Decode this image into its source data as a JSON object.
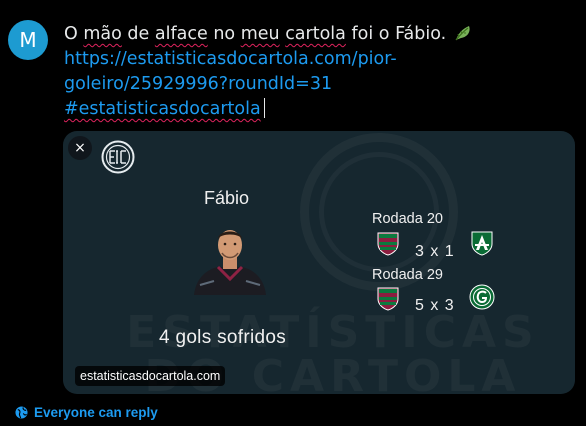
{
  "user": {
    "avatar_initial": "M"
  },
  "compose": {
    "words": [
      "O",
      "mão",
      "de",
      "alface",
      "no",
      "meu",
      "cartola",
      "foi",
      "o",
      "Fábio."
    ],
    "emoji": "lettuce",
    "link": "https://estatisticasdocartola.com/pior-goleiro/25929996?roundId=31",
    "hashtag": "#estatisticasdocartola"
  },
  "card": {
    "close_icon": "×",
    "player_name": "Fábio",
    "summary": "4 gols sofridos",
    "watermark_line1": "ESTATÍSTICAS",
    "watermark_line2": "DO CARTOLA",
    "domain": "estatisticasdocartola.com",
    "matches": [
      {
        "round": "Rodada 20",
        "score": "3 x 1",
        "home": "fluminense-badge",
        "away": "america-mg-badge"
      },
      {
        "round": "Rodada 29",
        "score": "5 x 3",
        "home": "fluminense-badge",
        "away": "goias-badge"
      }
    ]
  },
  "reply_setting": "Everyone can reply",
  "colors": {
    "accent": "#1d9bf0",
    "card_bg": "#16272f",
    "avatar_bg": "#1d9bd1",
    "spellcheck": "#e0245e"
  }
}
